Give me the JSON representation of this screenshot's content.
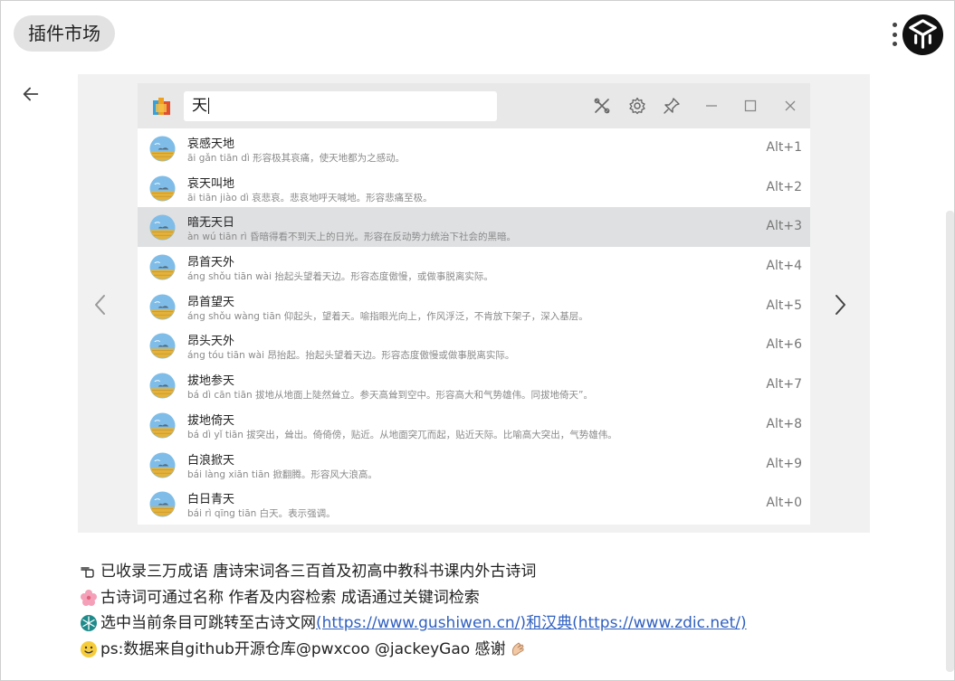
{
  "header": {
    "title": "插件市场"
  },
  "slide": {
    "search_value": "天",
    "results": [
      {
        "title": "哀感天地",
        "desc": "āi gǎn tiān dì 形容极其哀痛，使天地都为之感动。",
        "shortcut": "Alt+1",
        "selected": false
      },
      {
        "title": "哀天叫地",
        "desc": "āi tiān jiào dì 哀悲哀。悲哀地呼天喊地。形容悲痛至极。",
        "shortcut": "Alt+2",
        "selected": false
      },
      {
        "title": "暗无天日",
        "desc": "àn wú tiān rì 昏暗得看不到天上的日光。形容在反动势力统治下社会的黑暗。",
        "shortcut": "Alt+3",
        "selected": true
      },
      {
        "title": "昂首天外",
        "desc": "áng shǒu tiān wài 抬起头望着天边。形容态度傲慢，或做事脱离实际。",
        "shortcut": "Alt+4",
        "selected": false
      },
      {
        "title": "昂首望天",
        "desc": "áng shǒu wàng tiān 仰起头，望着天。喻指眼光向上，作风浮泛，不肯放下架子，深入基层。",
        "shortcut": "Alt+5",
        "selected": false
      },
      {
        "title": "昂头天外",
        "desc": "áng tóu tiān wài 昂抬起。抬起头望着天边。形容态度傲慢或做事脱离实际。",
        "shortcut": "Alt+6",
        "selected": false
      },
      {
        "title": "拔地参天",
        "desc": "bá dì cān tiān 拔地从地面上陡然耸立。参天高耸到空中。形容高大和气势雄伟。同拔地倚天”。",
        "shortcut": "Alt+7",
        "selected": false
      },
      {
        "title": "拔地倚天",
        "desc": "bá dì yǐ tiān 拔突出，耸出。倚倚傍，贴近。从地面突兀而起，贴近天际。比喻高大突出，气势雄伟。",
        "shortcut": "Alt+8",
        "selected": false
      },
      {
        "title": "白浪掀天",
        "desc": "bái làng xiān tiān 掀翻腾。形容风大浪高。",
        "shortcut": "Alt+9",
        "selected": false
      },
      {
        "title": "白日青天",
        "desc": "bái rì qīng tiān 白天。表示强调。",
        "shortcut": "Alt+0",
        "selected": false
      }
    ]
  },
  "notes": {
    "line1": "已收录三万成语 唐诗宋词各三百首及初高中教科书课内外古诗词",
    "line2": "古诗词可通过名称 作者及内容检索 成语通过关键词检索",
    "line3_text": "选中当前条目可跳转至古诗文网",
    "line3_link1": "(https://www.gushiwen.cn/)和汉典(https://www.zdic.net/)",
    "line4": "ps:数据来自github开源仓库@pwxcoo @jackeyGao 感谢"
  },
  "icons": {
    "back": "back-arrow-icon",
    "more": "more-vertical-icon",
    "logo": "app-logo-icon",
    "prev": "chevron-left-icon",
    "next": "chevron-right-icon",
    "settings_tools": "tools-icon",
    "settings": "gear-icon",
    "pin": "pin-icon",
    "minimize": "minimize-icon",
    "maximize": "maximize-icon",
    "close": "close-icon"
  }
}
